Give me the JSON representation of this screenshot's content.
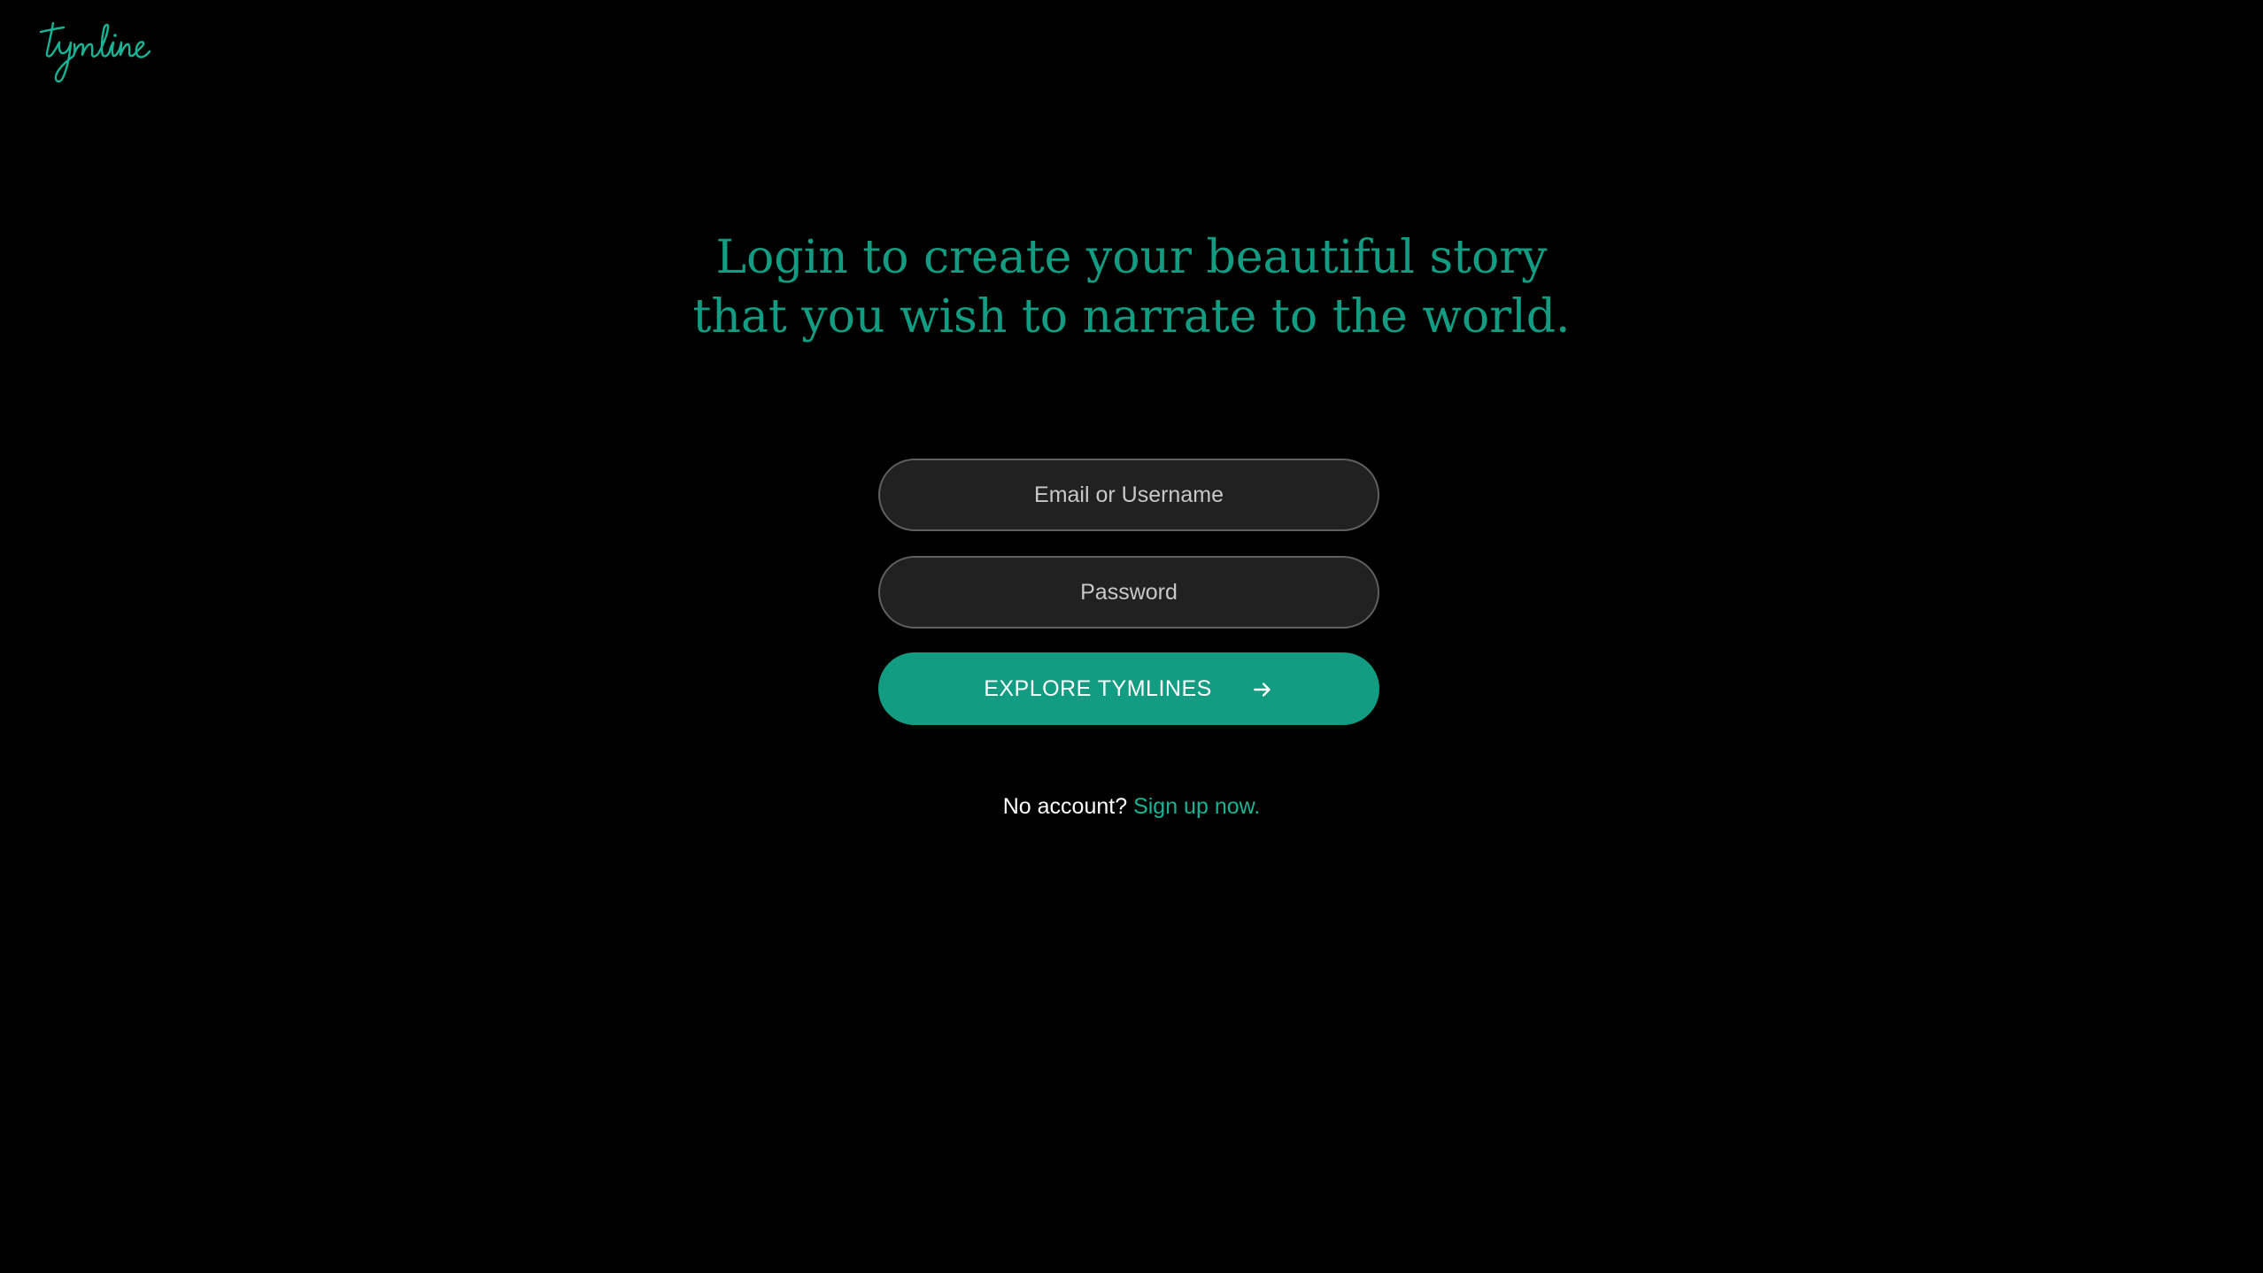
{
  "brand": {
    "logo_text": "tymline",
    "accent_color": "#129c82"
  },
  "headline": {
    "line1": "Login to create your beautiful story",
    "line2": "that you wish to narrate to the world."
  },
  "form": {
    "email_placeholder": "Email or Username",
    "email_value": "",
    "password_placeholder": "Password",
    "password_value": "",
    "submit_label": "EXPLORE TYMLINES",
    "submit_icon": "arrow-right-icon"
  },
  "signup": {
    "prompt": "No account?",
    "link_label": "Sign up now."
  }
}
